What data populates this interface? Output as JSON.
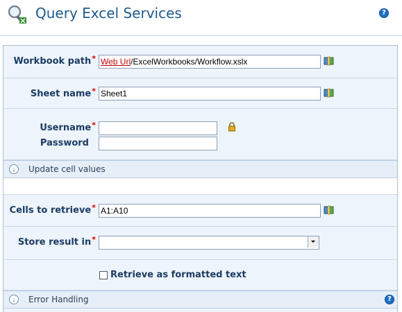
{
  "header": {
    "title": "Query Excel Services"
  },
  "form": {
    "workbook_path": {
      "label": "Workbook path",
      "value_link": "Web Url",
      "value_rest": "/ExcelWorkbooks/Workflow.xslx"
    },
    "sheet_name": {
      "label": "Sheet name",
      "value": "Sheet1"
    },
    "username": {
      "label": "Username",
      "value": ""
    },
    "password": {
      "label": "Password",
      "value": ""
    },
    "update_section": {
      "title": "Update cell values"
    },
    "cells_to_retrieve": {
      "label": "Cells to retrieve",
      "value": "A1:A10"
    },
    "store_result_in": {
      "label": "Store result in",
      "value": ""
    },
    "retrieve_formatted": {
      "label": "Retrieve as formatted text",
      "checked": false
    },
    "error_section": {
      "title": "Error Handling"
    }
  },
  "required_marker": "*",
  "colors": {
    "title": "#1d5a8e",
    "label": "#1b3c63",
    "required": "#d40000",
    "row_bg": "#eef4fb"
  },
  "icons": [
    "magnifier-logo-icon",
    "help-icon",
    "lookup-book-icon",
    "lock-icon",
    "chevron-down-icon",
    "dropdown-arrow-icon"
  ]
}
